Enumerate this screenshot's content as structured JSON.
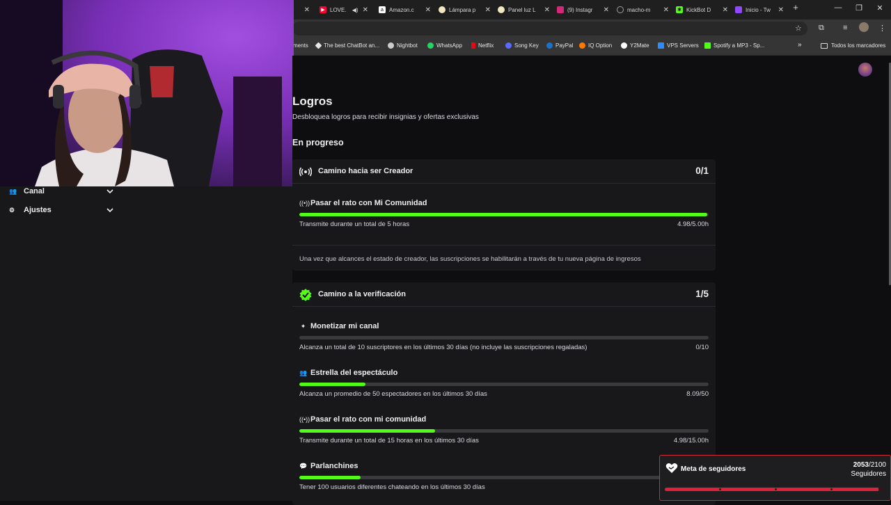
{
  "browser": {
    "tabs": [
      {
        "title": "",
        "icon": "tab-icon",
        "color": "#666666"
      },
      {
        "title": "LOVE.",
        "icon": "youtube-icon",
        "color": "#ff0033"
      },
      {
        "title": "Amazon.c",
        "icon": "amazon-icon",
        "color": "#ffffff"
      },
      {
        "title": "Lámpara p",
        "icon": "lamp-icon",
        "color": "#f0e6c0"
      },
      {
        "title": "Panel luz L",
        "icon": "panel-icon",
        "color": "#f0e6c0"
      },
      {
        "title": "(9) Instagr",
        "icon": "instagram-icon",
        "color": "#d6287a"
      },
      {
        "title": "macho-m",
        "icon": "globe-icon",
        "color": "#9aa0a6"
      },
      {
        "title": "KickBot D",
        "icon": "kickbot-icon",
        "color": "#53fc18"
      },
      {
        "title": "Inicio - Tw",
        "icon": "twitch-icon",
        "color": "#9146ff"
      }
    ],
    "bookmarks": [
      {
        "label": "ments",
        "color": "#353535"
      },
      {
        "label": "The best ChatBot an...",
        "color": "#e6e6e6"
      },
      {
        "label": "Nightbot",
        "color": "#cccccc"
      },
      {
        "label": "WhatsApp",
        "color": "#25d366"
      },
      {
        "label": "Netflix",
        "color": "#e50914"
      },
      {
        "label": "Song Key",
        "color": "#5b6bff"
      },
      {
        "label": "PayPal",
        "color": "#1a73c8"
      },
      {
        "label": "IQ Option",
        "color": "#ff7a00"
      },
      {
        "label": "Y2Mate",
        "color": "#ffffff"
      },
      {
        "label": "VPS Servers",
        "color": "#2d8cff"
      },
      {
        "label": "Spotify a MP3 - Sp...",
        "color": "#53fc18"
      }
    ],
    "all_bookmarks": "Todos los marcadores"
  },
  "sidebar": {
    "items": [
      {
        "label": "Canal",
        "icon": "channel-icon"
      },
      {
        "label": "Ajustes",
        "icon": "settings-gear-icon"
      }
    ]
  },
  "page": {
    "title": "Logros",
    "subtitle": "Desbloquea logros para recibir insignias y ofertas exclusivas",
    "section": "En progreso"
  },
  "cards": [
    {
      "title": "Camino hacia ser Creador",
      "count": "0/1",
      "achievements": [
        {
          "title": "Pasar el rato con Mi Comunidad",
          "icon": "broadcast-icon",
          "desc": "Transmite durante un total de 5 horas",
          "value": "4.98/5.00h",
          "progress": 0.996
        }
      ],
      "note": "Una vez que alcances el estado de creador, las suscripciones se habilitarán a través de tu nueva página de ingresos"
    },
    {
      "title": "Camino a la verificación",
      "count": "1/5",
      "achievements": [
        {
          "title": "Monetizar mi canal",
          "icon": "sparkle-icon",
          "desc": "Alcanza un total de 10 suscriptores en los últimos 30 días (no incluye las suscripciones regaladas)",
          "value": "0/10",
          "progress": 0
        },
        {
          "title": "Estrella del espectáculo",
          "icon": "users-icon",
          "desc": "Alcanza un promedio de 50 espectadores en los últimos 30 días",
          "value": "8.09/50",
          "progress": 0.1618
        },
        {
          "title": "Pasar el rato con mi comunidad",
          "icon": "broadcast-icon",
          "desc": "Transmite durante un total de 15 horas en los últimos 30 días",
          "value": "4.98/15.00h",
          "progress": 0.332
        },
        {
          "title": "Parlanchines",
          "icon": "chat-bubble-icon",
          "desc": "Tener 100 usuarios diferentes chateando en los últimos 30 días",
          "value": "",
          "progress": 0.15
        }
      ]
    }
  ],
  "goal": {
    "label": "Meta de seguidores",
    "current": "2053",
    "target": "/2100",
    "unit": "Seguidores",
    "progress": 0.9776,
    "accent": "#e0213a"
  },
  "colors": {
    "progress": "#53fc18",
    "background": "#0e0e10",
    "card": "#18181b"
  }
}
